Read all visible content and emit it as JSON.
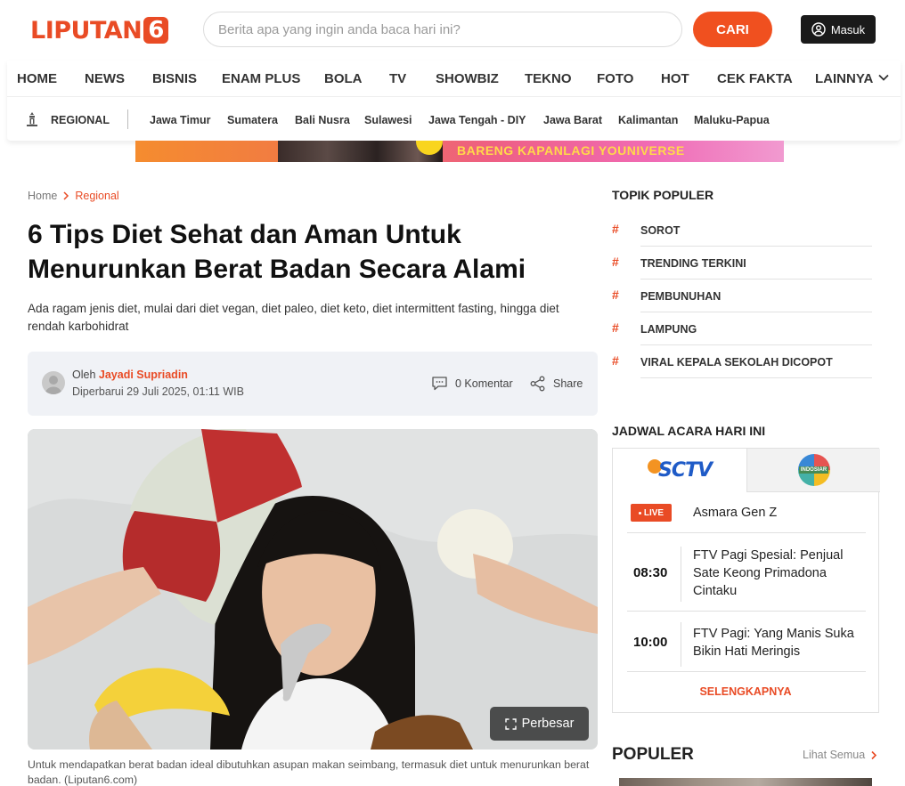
{
  "header": {
    "logo_text": "LIPUTAN",
    "logo_number": "6",
    "search_placeholder": "Berita apa yang ingin anda baca hari ini?",
    "search_button": "CARI",
    "login_label": "Masuk"
  },
  "nav": {
    "items": [
      "HOME",
      "NEWS",
      "BISNIS",
      "ENAM PLUS",
      "BOLA",
      "TV",
      "SHOWBIZ",
      "TEKNO",
      "FOTO",
      "HOT",
      "CEK FAKTA",
      "LAINNYA"
    ]
  },
  "subnav": {
    "section": "REGIONAL",
    "items": [
      "Jawa Timur",
      "Sumatera",
      "Bali Nusra",
      "Sulawesi",
      "Jawa Tengah - DIY",
      "Jawa Barat",
      "Kalimantan",
      "Maluku-Papua"
    ]
  },
  "banner": {
    "text": "BARENG KAPANLAGI YOUNIVERSE"
  },
  "breadcrumb": {
    "home": "Home",
    "current": "Regional"
  },
  "article": {
    "title": "6 Tips Diet Sehat dan Aman Untuk Menurunkan Berat Badan Secara Alami",
    "lede": "Ada ragam jenis diet, mulai dari diet vegan, diet paleo, diet keto, diet intermittent fasting, hingga diet rendah karbohidrat",
    "by_label": "Oleh",
    "author": "Jayadi Supriadin",
    "updated": "Diperbarui 29 Juli 2025, 01:11 WIB",
    "comments": "0 Komentar",
    "share": "Share",
    "enlarge": "Perbesar",
    "caption": "Untuk mendapatkan berat badan ideal dibutuhkan asupan makan seimbang, termasuk diet untuk menurunkan berat badan. (Liputan6.com)"
  },
  "sidebar": {
    "topics_heading": "TOPIK POPULER",
    "topics": [
      "SOROT",
      "TRENDING TERKINI",
      "PEMBUNUHAN",
      "LAMPUNG",
      "VIRAL KEPALA SEKOLAH DICOPOT"
    ],
    "schedule_heading": "JADWAL ACARA HARI INI",
    "channels": [
      "SCTV",
      "INDOSIAR"
    ],
    "live_label": "LIVE",
    "programs": [
      {
        "time": "",
        "title": "Asmara Gen Z"
      },
      {
        "time": "08:30",
        "title": "FTV Pagi Spesial: Penjual Sate Keong Primadona Cintaku"
      },
      {
        "time": "10:00",
        "title": "FTV Pagi: Yang Manis Suka Bikin Hati Meringis"
      }
    ],
    "more_label": "SELENGKAPNYA",
    "popular_heading": "POPULER",
    "see_all": "Lihat Semua"
  },
  "colors": {
    "brand": "#e94b25",
    "search_button": "#f0501f",
    "login_button": "#1a1a1a",
    "meta_bg": "#f0f2f6"
  },
  "icons": [
    "user-circle-icon",
    "chevron-down-icon",
    "monument-icon",
    "chevron-right-icon",
    "comment-icon",
    "share-icon",
    "expand-icon"
  ]
}
